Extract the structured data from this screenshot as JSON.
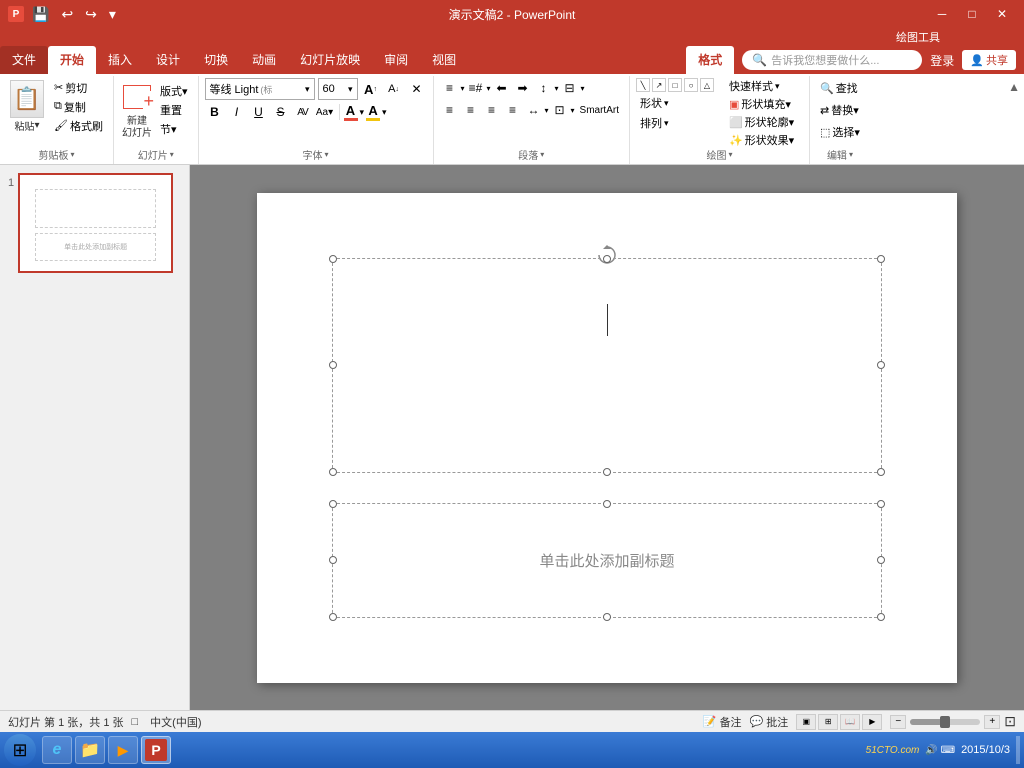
{
  "titlebar": {
    "title": "演示文稿2 - PowerPoint",
    "drawing_tools": "绘图工具",
    "quick_save": "💾",
    "undo": "↩",
    "redo": "↪"
  },
  "tabs": {
    "items": [
      "文件",
      "开始",
      "插入",
      "设计",
      "切换",
      "动画",
      "幻灯片放映",
      "审阅",
      "视图",
      "格式"
    ],
    "active": "开始",
    "drawing_tab": "格式"
  },
  "search_bar": {
    "placeholder": "告诉我您想要做什么...",
    "login": "登录",
    "share": "共享"
  },
  "ribbon": {
    "clipboard": {
      "label": "剪贴板",
      "paste": "粘贴",
      "cut": "剪切",
      "copy": "复制",
      "format_painter": "格式刷"
    },
    "slides": {
      "label": "幻灯片",
      "new_slide": "新建\n幻灯片",
      "layout": "版式▾",
      "reset": "重置",
      "section": "节▾"
    },
    "font": {
      "label": "字体",
      "font_name": "等线 Light",
      "font_size": "60",
      "bold": "B",
      "italic": "I",
      "underline": "U",
      "strikethrough": "S",
      "char_spacing": "AV",
      "change_case": "Aa▾",
      "font_color": "A",
      "increase": "A↑",
      "decrease": "A↓",
      "clear": "✕",
      "highlight": "A▾"
    },
    "paragraph": {
      "label": "段落",
      "bullets": "≡",
      "numbering": "≡#",
      "decrease_indent": "⬅",
      "increase_indent": "➡",
      "line_spacing": "↕",
      "columns": "⊟",
      "align_left": "≡",
      "align_center": "≡",
      "align_right": "≡",
      "justify": "≡",
      "text_direction": "⬆",
      "align_text": "⊡",
      "smart_art": "SmartArt"
    },
    "drawing": {
      "label": "绘图",
      "shapes": "形状",
      "arrange": "排列",
      "quick_styles": "快速样式",
      "fill": "形状填充▾",
      "outline": "形状轮廓▾",
      "effects": "形状效果▾"
    },
    "editing": {
      "label": "编辑",
      "find": "查找",
      "replace": "替换▾",
      "select": "选择▾"
    }
  },
  "slide": {
    "number": "1",
    "subtitle_placeholder": "单击此处添加副标题",
    "total": "共 1 张"
  },
  "statusbar": {
    "slide_info": "幻灯片 第 1 张，共 1 张",
    "accessibility": "□",
    "language": "中文(中国)",
    "notes": "备注",
    "comments": "批注",
    "zoom": "—●——",
    "zoom_level": "—",
    "fit": "⊡"
  },
  "taskbar": {
    "start_icon": "⊞",
    "ie_icon": "e",
    "explorer_icon": "📁",
    "media_icon": "▶",
    "ppt_icon": "P",
    "time": "2015/10/3",
    "watermark": "51CTO.com"
  }
}
